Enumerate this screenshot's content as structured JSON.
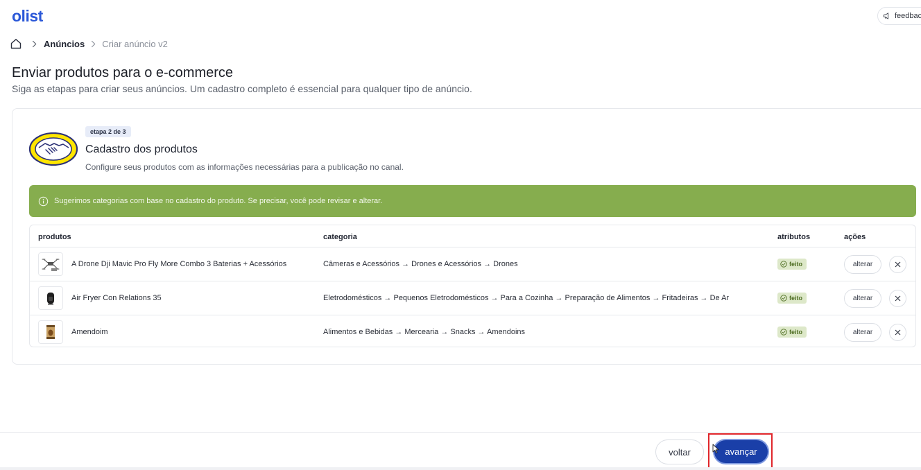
{
  "brand": {
    "logo_text": "olist",
    "accent": "#2b58d8"
  },
  "header": {
    "feedback_label": "feedbac",
    "feedback_icon": "megaphone-icon"
  },
  "breadcrumb": {
    "home_icon": "home-icon",
    "items": [
      {
        "label": "Anúncios"
      },
      {
        "label": "Criar anúncio v2"
      }
    ]
  },
  "page": {
    "title": "Enviar produtos para o e-commerce",
    "subtitle": "Siga as etapas para criar seus anúncios. Um cadastro completo é essencial para qualquer tipo de anúncio."
  },
  "step": {
    "badge": "etapa 2 de 3",
    "title": "Cadastro dos produtos",
    "description": "Configure seus produtos com as informações necessárias para a publicação no canal.",
    "channel_logo": "mercado-livre-logo"
  },
  "alert": {
    "icon": "info-icon",
    "text": "Sugerimos categorias com base no cadastro do produto. Se precisar, você pode revisar e alterar.",
    "color": "#86ad4e"
  },
  "table": {
    "columns": {
      "products": "produtos",
      "category": "categoria",
      "attributes": "atributos",
      "actions": "ações"
    },
    "rows": [
      {
        "thumb_icon": "drone-icon",
        "name": "A Drone Dji Mavic Pro Fly More Combo 3 Baterias + Acessórios",
        "category": "Câmeras e Acessórios → Drones e Acessórios → Drones",
        "status": "feito",
        "alter_label": "alterar"
      },
      {
        "thumb_icon": "air-fryer-icon",
        "name": "Air Fryer Con Relations 35",
        "category": "Eletrodomésticos → Pequenos Eletrodomésticos → Para a Cozinha → Preparação de Alimentos → Fritadeiras → De Ar",
        "status": "feito",
        "alter_label": "alterar"
      },
      {
        "thumb_icon": "peanut-package-icon",
        "name": "Amendoim",
        "category": "Alimentos e Bebidas → Mercearia → Snacks → Amendoins",
        "status": "feito",
        "alter_label": "alterar"
      }
    ]
  },
  "footer": {
    "back_label": "voltar",
    "next_label": "avançar",
    "primary_color": "#1a3fa8",
    "highlight_color": "#e0262b"
  }
}
